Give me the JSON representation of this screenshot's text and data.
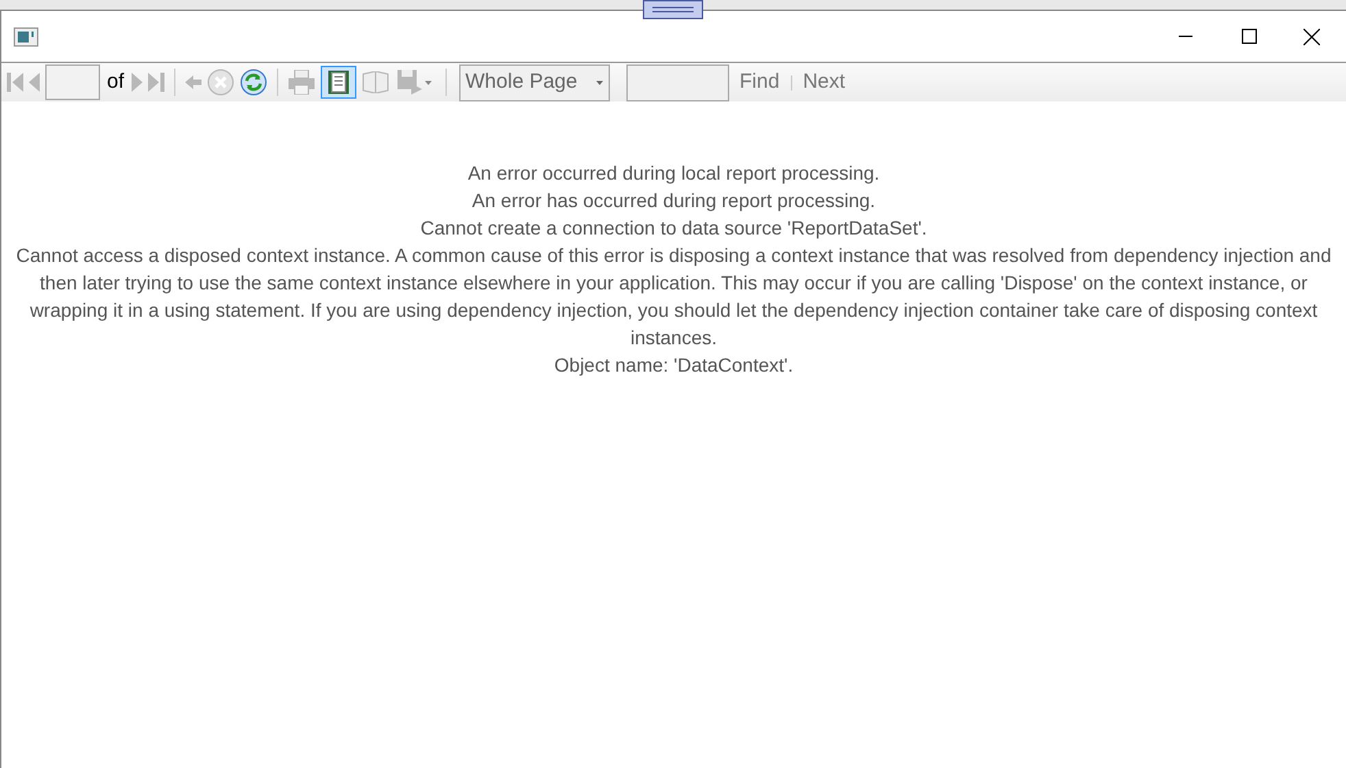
{
  "toolbar": {
    "items": [
      {
        "kind": "first",
        "disabled": true
      },
      {
        "kind": "prev",
        "disabled": true
      },
      {
        "kind": "page_input"
      },
      {
        "kind": "label",
        "text": "of"
      },
      {
        "kind": "next",
        "disabled": true
      },
      {
        "kind": "last",
        "disabled": true
      },
      {
        "kind": "sep"
      },
      {
        "kind": "back",
        "disabled": true
      },
      {
        "kind": "stop",
        "disabled": true
      },
      {
        "kind": "refresh",
        "disabled": false
      },
      {
        "kind": "sep"
      },
      {
        "kind": "print",
        "disabled": true
      },
      {
        "kind": "layout",
        "selected": true
      },
      {
        "kind": "pagesetup",
        "disabled": true
      },
      {
        "kind": "export",
        "disabled": true
      },
      {
        "kind": "sep"
      },
      {
        "kind": "zoom",
        "value": "Whole Page"
      },
      {
        "kind": "search"
      },
      {
        "kind": "link",
        "text": "Find"
      },
      {
        "kind": "linksep"
      },
      {
        "kind": "link",
        "text": "Next"
      }
    ]
  },
  "messages": [
    "An error occurred during local report processing.",
    "An error has occurred during report processing.",
    "Cannot create a connection to data source 'ReportDataSet'.",
    "Cannot access a disposed context instance. A common cause of this error is disposing a context instance that was resolved from dependency injection and then later trying to use the same context instance elsewhere in your application. This may occur if you are calling 'Dispose' on the context instance, or wrapping it in a using statement. If you are using dependency injection, you should let the dependency injection container take care of disposing context instances.",
    "Object name: 'DataContext'."
  ]
}
